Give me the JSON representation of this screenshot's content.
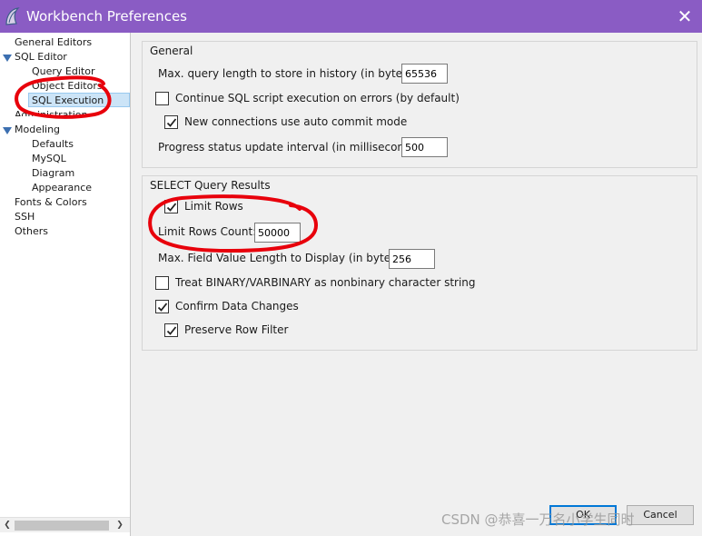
{
  "window": {
    "title": "Workbench Preferences",
    "close_glyph": "✕"
  },
  "sidebar": {
    "items": [
      {
        "label": "General Editors"
      },
      {
        "label": "SQL Editor"
      },
      {
        "label": "Query Editor"
      },
      {
        "label": "Object Editors"
      },
      {
        "label": "SQL Execution"
      },
      {
        "label": "Administration"
      },
      {
        "label": "Modeling"
      },
      {
        "label": "Defaults"
      },
      {
        "label": "MySQL"
      },
      {
        "label": "Diagram"
      },
      {
        "label": "Appearance"
      },
      {
        "label": "Fonts & Colors"
      },
      {
        "label": "SSH"
      },
      {
        "label": "Others"
      }
    ],
    "selected": "SQL Execution"
  },
  "general": {
    "title": "General",
    "max_query_label": "Max. query length to store in history (in bytes):",
    "max_query_value": "65536",
    "continue_label": "Continue SQL script execution on errors (by default)",
    "continue_checked": false,
    "autocommit_label": "New connections use auto commit mode",
    "autocommit_checked": true,
    "progress_label": "Progress status update interval (in milliseconds):",
    "progress_value": "500"
  },
  "select_results": {
    "title": "SELECT Query Results",
    "limit_rows_label": "Limit Rows",
    "limit_rows_checked": true,
    "limit_count_label": "Limit Rows Count:",
    "limit_count_value": "50000",
    "max_field_label": "Max. Field Value Length to Display (in bytes):",
    "max_field_value": "256",
    "binary_label": "Treat BINARY/VARBINARY as nonbinary character string",
    "binary_checked": false,
    "confirm_label": "Confirm Data Changes",
    "confirm_checked": true,
    "preserve_label": "Preserve Row Filter",
    "preserve_checked": true
  },
  "buttons": {
    "ok": "OK",
    "cancel": "Cancel"
  },
  "watermark": "CSDN @恭喜一万名小学生同时",
  "colors": {
    "titlebar": "#8a5cc4",
    "selection": "#cce4f7",
    "annotation": "#e8000b",
    "default_button_border": "#0078d7"
  }
}
